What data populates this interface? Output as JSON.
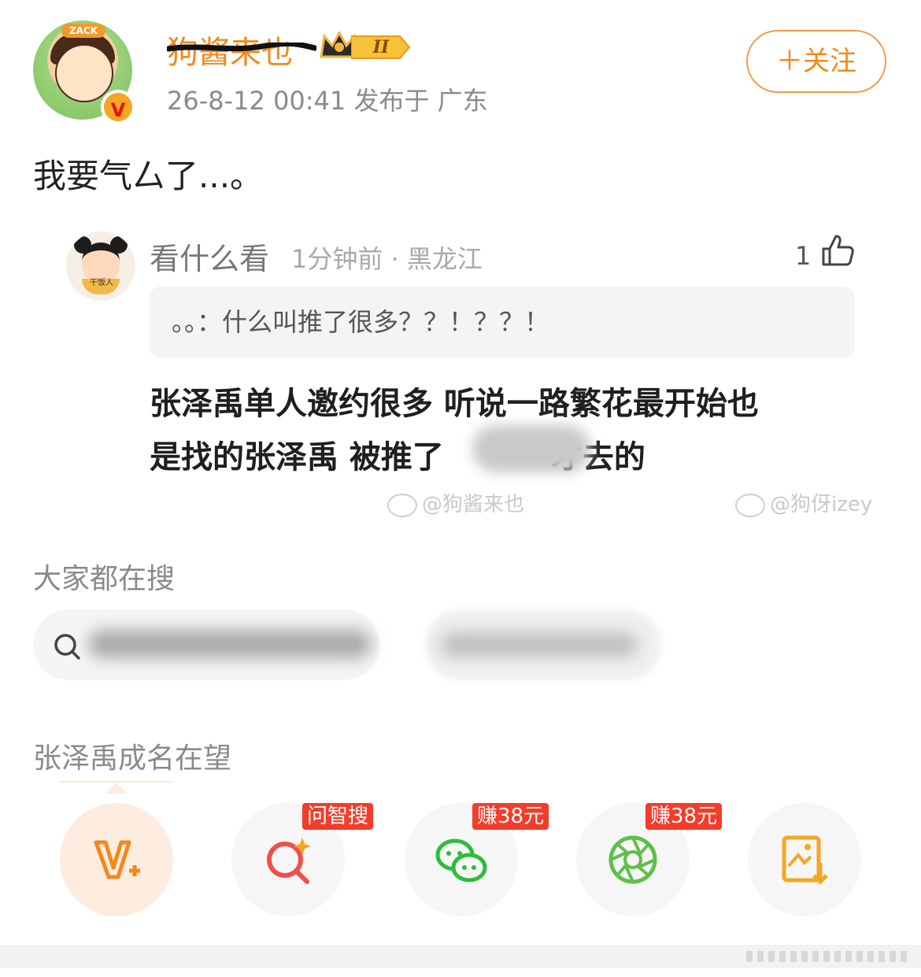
{
  "post": {
    "author": "狗酱来也",
    "rank_badge": "II",
    "meta": "26-8-12 00:41  发布于 广东",
    "follow_label": "＋关注",
    "text": "我要气厶了...。"
  },
  "comment": {
    "author": "看什么看",
    "time_location": "1分钟前 · 黑龙江",
    "like_count": "1",
    "quote": "。。：什么叫推了很多？？！？？！",
    "reply_line1": "张泽禹单人邀约很多  听说一路繁花最开始也",
    "reply_line2": "是找的张泽禹  被推了",
    "reply_line2_tail": "才去的",
    "watermark_left": "@狗酱来也",
    "watermark_right": "@狗伢izey",
    "avatar_tag": "干饭人"
  },
  "search": {
    "heading": "大家都在搜"
  },
  "topic": "张泽禹成名在望",
  "share": {
    "ai_badge": "问智搜",
    "wechat_badge": "赚38元",
    "moments_badge": "赚38元"
  },
  "avatar_tag": "ZACK",
  "colors": {
    "accent_orange": "#f08a1a",
    "badge_red": "#f43c2b",
    "wechat_green": "#2dbd3a"
  }
}
